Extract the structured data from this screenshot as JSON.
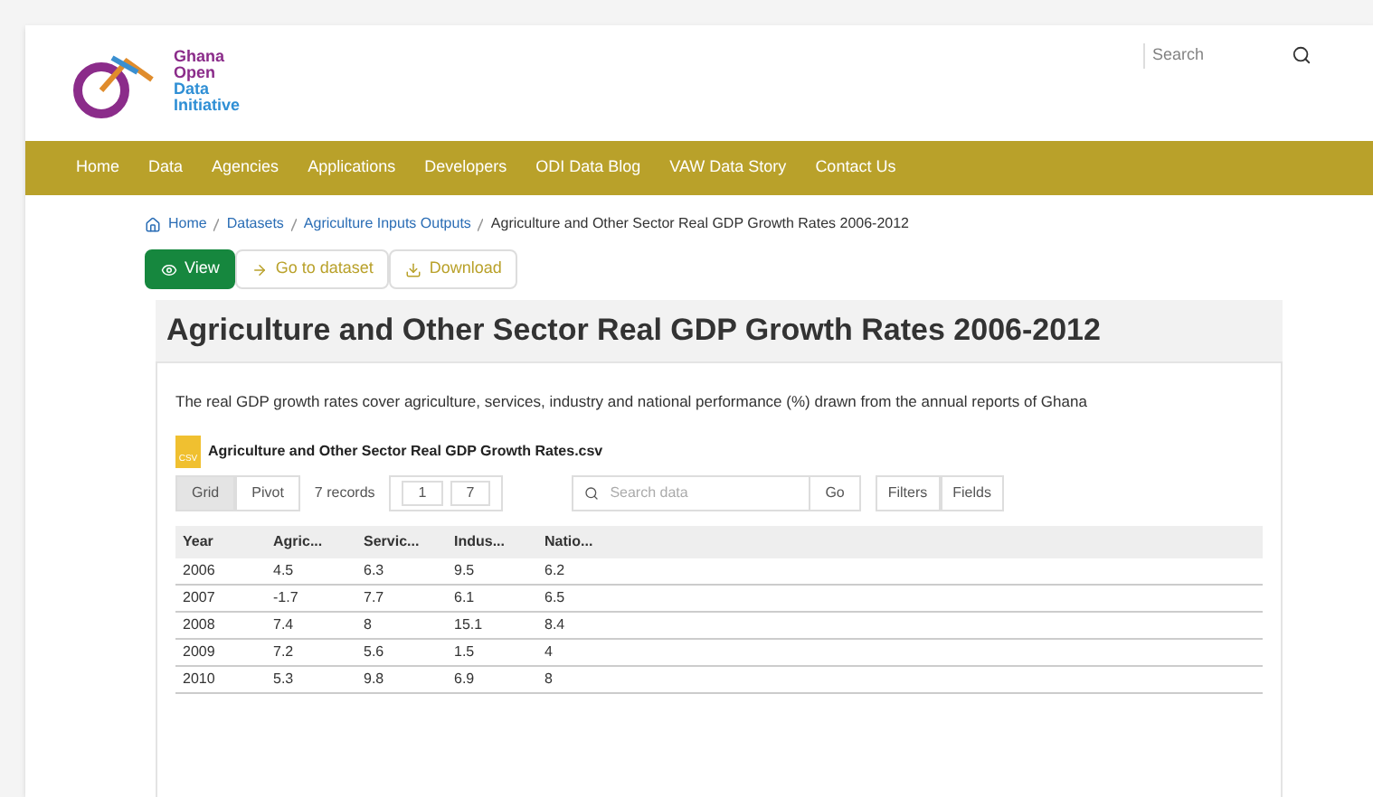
{
  "header": {
    "logo_lines": [
      "Ghana",
      "Open",
      "Data",
      "Initiative"
    ],
    "search": {
      "placeholder": "Search"
    }
  },
  "nav": [
    "Home",
    "Data",
    "Agencies",
    "Applications",
    "Developers",
    "ODI Data Blog",
    "VAW Data Story",
    "Contact Us"
  ],
  "breadcrumb": [
    "Home",
    "Datasets",
    "Agriculture Inputs Outputs",
    "Agriculture and Other Sector Real GDP Growth Rates 2006-2012"
  ],
  "actions": [
    {
      "label": "View",
      "selected": true
    },
    {
      "label": "Go to dataset",
      "selected": false
    },
    {
      "label": "Download",
      "selected": false
    }
  ],
  "title": "Agriculture and Other Sector Real GDP Growth Rates 2006-2012",
  "description": "The real GDP growth rates cover agriculture, services, industry and national performance (%) drawn from the annual reports of Ghana",
  "resource": {
    "name": "Agriculture and Other Sector Real GDP Growth Rates.csv",
    "file_type": "CSV"
  },
  "toolbar": {
    "views": [
      {
        "label": "Grid",
        "selected": true
      },
      {
        "label": "Pivot",
        "selected": false
      }
    ],
    "records": "7 records",
    "page_from": "1",
    "page_to": "7",
    "search": {
      "placeholder": "Search data"
    },
    "go": "Go",
    "buttons": [
      "Filters",
      "Fields"
    ]
  },
  "table": {
    "columns": [
      "Year",
      "Agric...",
      "Servic...",
      "Indus...",
      "Natio..."
    ],
    "rows": [
      [
        "2006",
        "4.5",
        "6.3",
        "9.5",
        "6.2"
      ],
      [
        "2007",
        "-1.7",
        "7.7",
        "6.1",
        "6.5"
      ],
      [
        "2008",
        "7.4",
        "8",
        "15.1",
        "8.4"
      ],
      [
        "2009",
        "7.2",
        "5.6",
        "1.5",
        "4"
      ],
      [
        "2010",
        "5.3",
        "9.8",
        "6.9",
        "8"
      ]
    ]
  }
}
